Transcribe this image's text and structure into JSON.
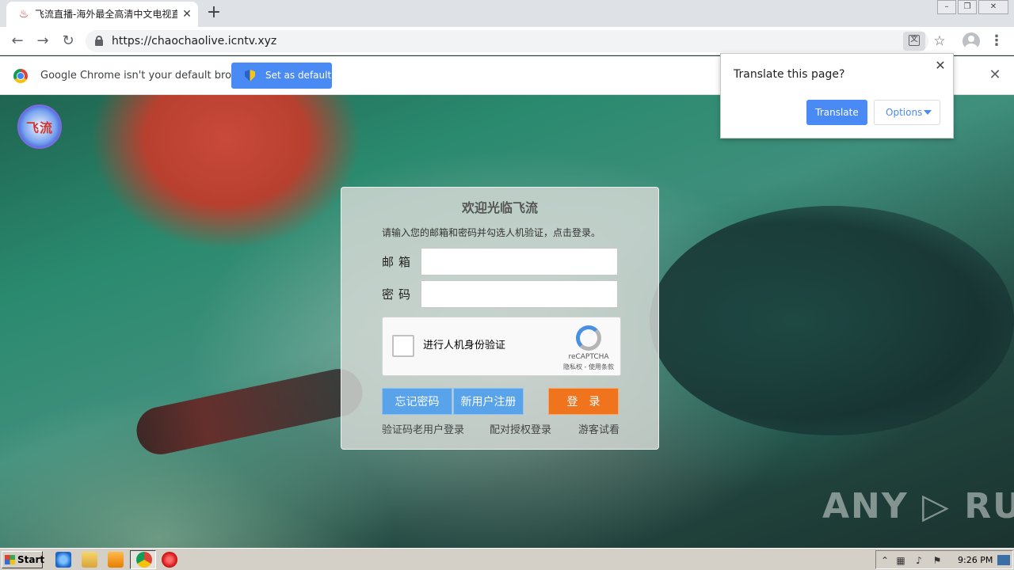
{
  "browser": {
    "tab": {
      "title": "飞流直播-海外最全高清中文电视直播",
      "favicon_icon": "feiliu-logo-icon",
      "close": "✕"
    },
    "new_tab": "+",
    "window_controls": [
      "–",
      "❐",
      "✕"
    ],
    "nav": {
      "back": "←",
      "forward": "→",
      "reload": "↻"
    },
    "url": "https://chaochaolive.icntv.xyz",
    "icons": [
      "lock-icon",
      "translate-icon",
      "star-icon",
      "profile-icon",
      "menu-icon"
    ],
    "star": "☆",
    "menu": "⋮"
  },
  "infobar": {
    "message": "Google Chrome isn't your default browser",
    "button_label": "Set as default",
    "close": "✕"
  },
  "translate_popup": {
    "title": "Translate this page?",
    "translate_label": "Translate",
    "options_label": "Options",
    "close": "✕"
  },
  "page": {
    "logo_text": "飞流",
    "watermark": "ANY ▷ RUN",
    "login": {
      "title": "欢迎光临飞流",
      "hint": "请输入您的邮箱和密码并勾选人机验证，点击登录。",
      "email_label": "邮箱",
      "password_label": "密码",
      "email_value": "",
      "password_value": "",
      "captcha": {
        "label": "进行人机身份验证",
        "brand": "reCAPTCHA",
        "links": "隐私权 - 使用条款"
      },
      "buttons": {
        "forgot": "忘记密码",
        "register": "新用户注册",
        "login": "登录"
      },
      "links": {
        "code_login": "验证码老用户登录",
        "pair_login": "配对授权登录",
        "guest": "游客试看"
      }
    }
  },
  "taskbar": {
    "start_label": "Start",
    "clock": "9:26 PM",
    "colors": {
      "accent": "#4a8af4",
      "login_orange": "#f0731e",
      "login_blue": "#58a3ea"
    }
  }
}
